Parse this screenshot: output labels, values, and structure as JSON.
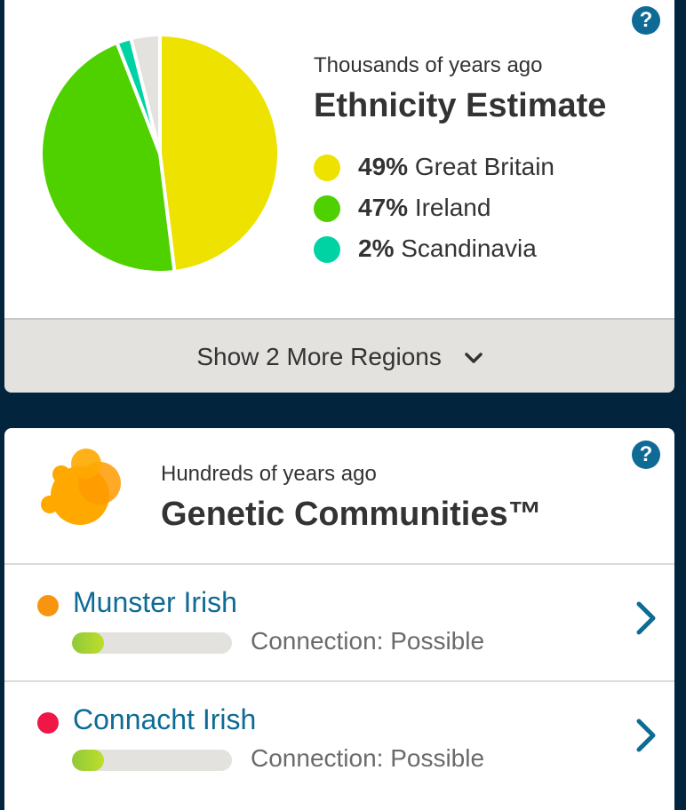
{
  "ethnicity": {
    "subtitle": "Thousands of years ago",
    "title": "Ethnicity Estimate",
    "regions": [
      {
        "percent": "49%",
        "name": "Great Britain",
        "color": "#ede200",
        "value": 49
      },
      {
        "percent": "47%",
        "name": "Ireland",
        "color": "#4fd100",
        "value": 47
      },
      {
        "percent": "2%",
        "name": "Scandinavia",
        "color": "#00d3a3",
        "value": 2
      }
    ],
    "other_slice": {
      "color": "#e3e2de",
      "value": 4
    },
    "more_label": "Show 2 More Regions",
    "help_icon": "question-icon"
  },
  "communities": {
    "subtitle": "Hundreds of years ago",
    "title": "Genetic Communities™",
    "items": [
      {
        "name": "Munster Irish",
        "connection": "Connection: Possible",
        "color": "#f7960e",
        "level": 0.2
      },
      {
        "name": "Connacht Irish",
        "connection": "Connection: Possible",
        "color": "#ee1747",
        "level": 0.2
      }
    ]
  },
  "colors": {
    "link": "#0e6b96",
    "background": "#02243d"
  }
}
